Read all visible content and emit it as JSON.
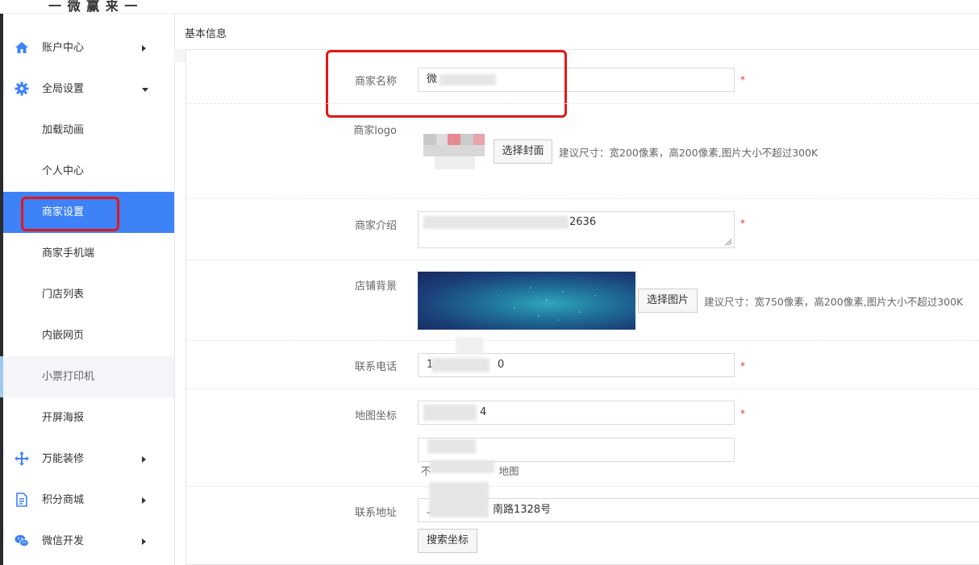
{
  "logo": {
    "text": "一 微 赢 来 一"
  },
  "section_title": "基本信息",
  "sidebar": {
    "items": [
      {
        "label": "账户中心",
        "icon": "home-icon",
        "arrow": "right"
      },
      {
        "label": "全局设置",
        "icon": "gear-icon",
        "arrow": "down"
      },
      {
        "label": "加载动画"
      },
      {
        "label": "个人中心"
      },
      {
        "label": "商家设置",
        "state": "active"
      },
      {
        "label": "商家手机端"
      },
      {
        "label": "门店列表"
      },
      {
        "label": "内嵌网页"
      },
      {
        "label": "小票打印机",
        "state": "hover"
      },
      {
        "label": "开屏海报"
      },
      {
        "label": "万能装修",
        "icon": "move-icon",
        "arrow": "right"
      },
      {
        "label": "积分商城",
        "icon": "document-icon",
        "arrow": "right"
      },
      {
        "label": "微信开发",
        "icon": "wechat-icon",
        "arrow": "right"
      }
    ]
  },
  "form": {
    "merchant_name": {
      "label": "商家名称",
      "value": "微",
      "required": "*"
    },
    "merchant_logo": {
      "label": "商家logo",
      "button": "选择封面",
      "hint": "建议尺寸：宽200像素，高200像素,图片大小不超过300K"
    },
    "merchant_intro": {
      "label": "商家介绍",
      "value": "2636",
      "required": "*"
    },
    "store_background": {
      "label": "店铺背景",
      "button": "选择图片",
      "hint": "建议尺寸：宽750像素，高200像素,图片大小不超过300K"
    },
    "phone": {
      "label": "联系电话",
      "value": "1",
      "value_tail": "0",
      "required": "*"
    },
    "map_coord": {
      "label": "地图坐标",
      "value": "4",
      "required": "*",
      "note_prefix": "不",
      "note_suffix": "地图"
    },
    "address": {
      "label": "联系地址",
      "value_prefix": "上",
      "value_suffix": "南路1328号",
      "button": "搜索坐标"
    }
  },
  "colors": {
    "accent": "#3d82f7",
    "highlight_border": "#e21818",
    "required": "#e03a3a"
  }
}
